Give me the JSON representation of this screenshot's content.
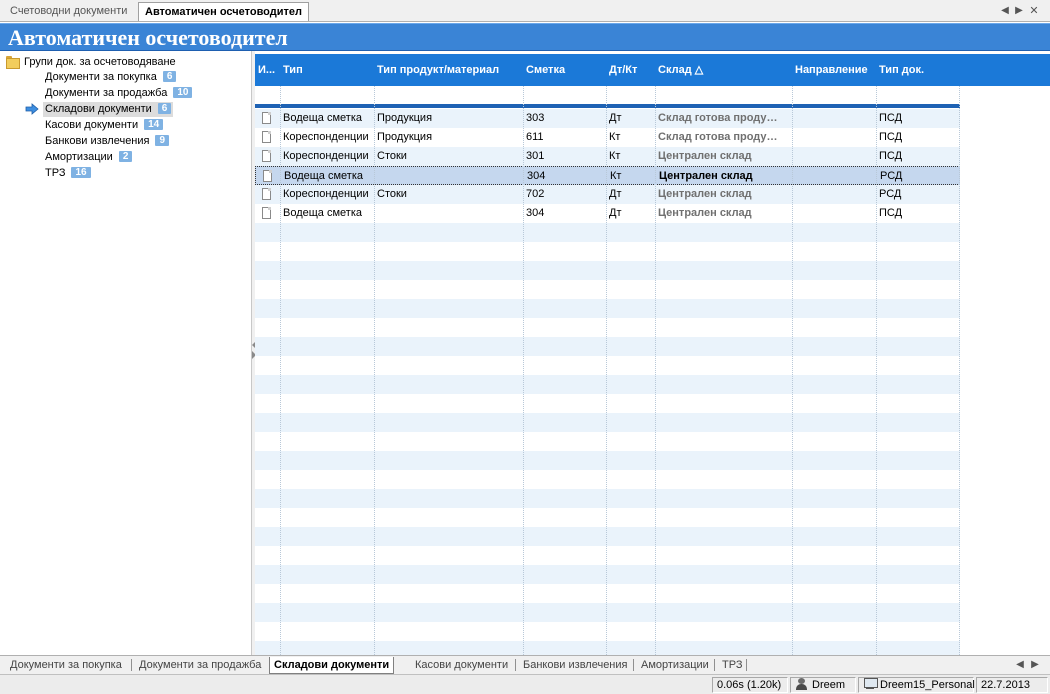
{
  "doc_tabs": [
    {
      "label": "Счетоводни документи",
      "active": false
    },
    {
      "label": "Автоматичен осчетоводител",
      "active": true
    }
  ],
  "tab_controls": {
    "prev": "◀",
    "next": "▶",
    "close": "✕"
  },
  "banner": {
    "title": "Автоматичен осчетоводител"
  },
  "tree": {
    "root_label": "Групи док. за осчетоводяване",
    "items": [
      {
        "label": "Документи за покупка",
        "count": "6"
      },
      {
        "label": "Документи за продажба",
        "count": "10"
      },
      {
        "label": "Складови документи",
        "count": "6",
        "selected": true
      },
      {
        "label": "Касови документи",
        "count": "14"
      },
      {
        "label": "Банкови извлечения",
        "count": "9"
      },
      {
        "label": "Амортизации",
        "count": "2"
      },
      {
        "label": "ТРЗ",
        "count": "16"
      }
    ]
  },
  "grid": {
    "columns": [
      "И...",
      "Тип",
      "Тип продукт/материал",
      "Сметка",
      "Дт/Кт",
      "Склад △",
      "Направление",
      "Тип док."
    ],
    "rows": [
      {
        "type": "Водеща сметка",
        "product_type": "Продукция",
        "account": "303",
        "dc": "Дт",
        "warehouse": "Склад готова проду…",
        "direction": "",
        "doc_type": "ПСД"
      },
      {
        "type": "Кореспонденции",
        "product_type": "Продукция",
        "account": "611",
        "dc": "Кт",
        "warehouse": "Склад готова проду…",
        "direction": "",
        "doc_type": "ПСД"
      },
      {
        "type": "Кореспонденции",
        "product_type": "Стоки",
        "account": "301",
        "dc": "Кт",
        "warehouse": "Централен склад",
        "direction": "",
        "doc_type": "ПСД"
      },
      {
        "type": "Водеща сметка",
        "product_type": "",
        "account": "304",
        "dc": "Кт",
        "warehouse": "Централен склад",
        "direction": "",
        "doc_type": "РСД",
        "selected": true
      },
      {
        "type": "Кореспонденции",
        "product_type": "Стоки",
        "account": "702",
        "dc": "Дт",
        "warehouse": "Централен склад",
        "direction": "",
        "doc_type": "РСД"
      },
      {
        "type": "Водеща сметка",
        "product_type": "",
        "account": "304",
        "dc": "Дт",
        "warehouse": "Централен склад",
        "direction": "",
        "doc_type": "ПСД"
      }
    ]
  },
  "bottom_tabs": [
    {
      "label": "Документи за покупка",
      "active": false
    },
    {
      "label": "Документи за продажба",
      "active": false
    },
    {
      "label": "Складови документи",
      "active": true
    },
    {
      "label": "Касови документи",
      "active": false
    },
    {
      "label": "Банкови извлечения",
      "active": false
    },
    {
      "label": "Амортизации",
      "active": false
    },
    {
      "label": "ТРЗ",
      "active": false
    }
  ],
  "bottom_nav": {
    "prev": "◀",
    "next": "▶"
  },
  "status": {
    "timing": "0.06s (1.20k)",
    "user": "Dreem",
    "database": "Dreem15_Personal",
    "date": "22.7.2013"
  },
  "colors": {
    "banner": "#3a84d6",
    "grid_header": "#1b79d8",
    "badge": "#7fb2e3",
    "selected_row": "#c5d7ee",
    "alt_row": "#eaf3fb"
  }
}
